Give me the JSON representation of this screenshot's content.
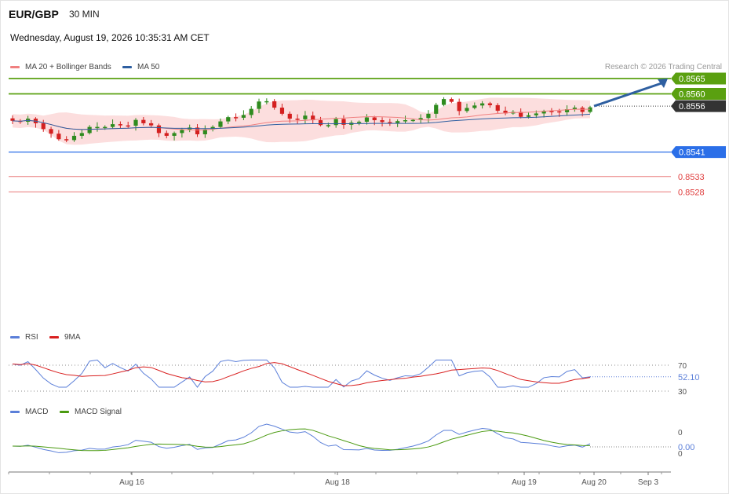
{
  "header": {
    "pair": "EUR/GBP",
    "timeframe": "30 MIN",
    "datetime": "Wednesday, August 19, 2026 10:35:31 AM CET",
    "credit": "Research © 2026 Trading Central"
  },
  "legends": {
    "main": [
      {
        "label": "MA 20 + Bollinger Bands",
        "color": "#f08080"
      },
      {
        "label": "MA 50",
        "color": "#2e5fa1"
      }
    ],
    "rsi": [
      {
        "label": "RSI",
        "color": "#5b7fd9"
      },
      {
        "label": "9MA",
        "color": "#d92020"
      }
    ],
    "macd": [
      {
        "label": "MACD",
        "color": "#5b7fd9"
      },
      {
        "label": "MACD Signal",
        "color": "#4a9a10"
      }
    ]
  },
  "colors": {
    "up": "#2e8b1e",
    "down": "#d42020",
    "resistance": "#5aa010",
    "support": "#2b6fe8",
    "pivot_low": "#e04040",
    "band_fill": "#fbd3d3",
    "ma20": "#f08080",
    "ma50": "#2e5fa1",
    "arrow": "#2e5fa1",
    "last_price_tag": "#333333"
  },
  "chart_data": {
    "type": "candlestick",
    "symbol": "EUR/GBP",
    "interval": "30 MIN",
    "x_ticks": [
      "Aug 16",
      "Aug 18",
      "Aug 19",
      "Aug 20",
      "Sep 3"
    ],
    "y_range": [
      0.8525,
      0.8567
    ],
    "last_price": 0.8556,
    "forecast_target": 0.8565,
    "levels": [
      {
        "price": 0.8565,
        "label": "0.8565",
        "role": "resistance",
        "tag": "green"
      },
      {
        "price": 0.856,
        "label": "0.8560",
        "role": "resistance",
        "tag": "green"
      },
      {
        "price": 0.8556,
        "label": "0.8556",
        "role": "last",
        "tag": "dark"
      },
      {
        "price": 0.8541,
        "label": "0.8541",
        "role": "support",
        "tag": "blue"
      },
      {
        "price": 0.8533,
        "label": "0.8533",
        "role": "pivot_low",
        "tag": "text"
      },
      {
        "price": 0.8528,
        "label": "0.8528",
        "role": "pivot_low",
        "tag": "text"
      }
    ],
    "candle_closes": [
      0.85512,
      0.85509,
      0.85519,
      0.85504,
      0.85485,
      0.8547,
      0.85452,
      0.85449,
      0.85463,
      0.85472,
      0.85492,
      0.85492,
      0.85492,
      0.85501,
      0.85497,
      0.85496,
      0.85515,
      0.85504,
      0.85497,
      0.85472,
      0.85463,
      0.85472,
      0.85482,
      0.8549,
      0.85468,
      0.85484,
      0.85492,
      0.8551,
      0.85524,
      0.85522,
      0.85531,
      0.85551,
      0.85575,
      0.85576,
      0.85555,
      0.85535,
      0.85519,
      0.85517,
      0.85529,
      0.85514,
      0.85498,
      0.85498,
      0.85518,
      0.85499,
      0.85506,
      0.85509,
      0.85523,
      0.85514,
      0.85508,
      0.85505,
      0.85511,
      0.85514,
      0.85515,
      0.85521,
      0.85535,
      0.85564,
      0.85583,
      0.85574,
      0.85544,
      0.85554,
      0.85562,
      0.85569,
      0.85563,
      0.85545,
      0.85536,
      0.85541,
      0.85525,
      0.8553,
      0.85536,
      0.85544,
      0.85543,
      0.8554,
      0.8555,
      0.85555,
      0.85541,
      0.85556
    ],
    "rsi": {
      "levels": [
        70,
        30
      ],
      "latest": 52.1,
      "label": "52.10"
    },
    "macd": {
      "latest": 0.0,
      "label": "0.00",
      "axis_ticks": [
        "0",
        "0"
      ]
    }
  }
}
